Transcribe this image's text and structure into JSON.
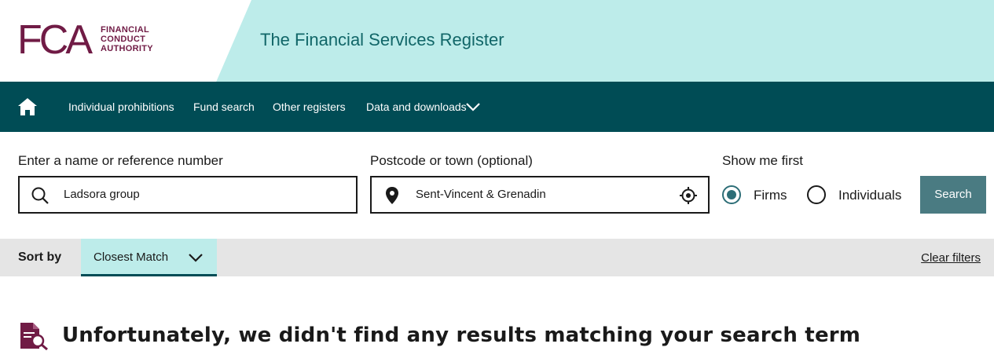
{
  "header": {
    "logo_letters": "FCA",
    "logo_lines": [
      "FINANCIAL",
      "CONDUCT",
      "AUTHORITY"
    ],
    "title": "The Financial Services Register"
  },
  "nav": {
    "home_icon": "home-icon",
    "items": [
      {
        "label": "Individual prohibitions"
      },
      {
        "label": "Fund search"
      },
      {
        "label": "Other registers"
      },
      {
        "label": "Data and downloads"
      }
    ],
    "dropdown_icon": "chevron-down-icon"
  },
  "search": {
    "name_label": "Enter a name or reference number",
    "name_value": "Ladsora group",
    "location_label": "Postcode or town (optional)",
    "location_value": "Sent-Vincent & Grenadin",
    "show_label": "Show me first",
    "options": [
      {
        "label": "Firms",
        "checked": true
      },
      {
        "label": "Individuals",
        "checked": false
      }
    ],
    "button_label": "Search"
  },
  "sort": {
    "label": "Sort by",
    "selected": "Closest Match",
    "clear_label": "Clear filters"
  },
  "results": {
    "message": "Unfortunately, we didn't find any results matching your search term"
  },
  "colors": {
    "brand": "#701b45",
    "header_bg": "#bdecea",
    "nav_bg": "#004c55",
    "accent": "#4a7b82"
  }
}
